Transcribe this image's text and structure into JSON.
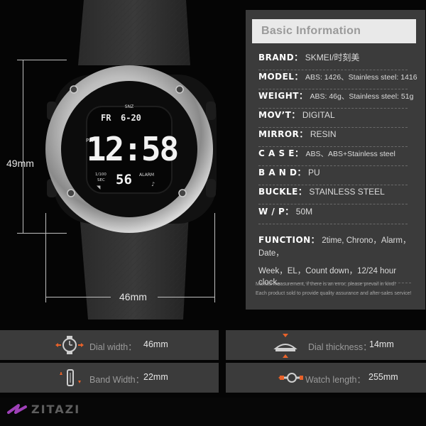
{
  "dimensions": {
    "height_label": "49mm",
    "width_label": "46mm"
  },
  "watch_face": {
    "snz": "SNZ",
    "day": "FR",
    "date": "6-20",
    "time": "12:58",
    "pm": "PM",
    "fraction": "1/100",
    "sec": "SEC",
    "seconds": "56",
    "alarm": "ALARM"
  },
  "info": {
    "title": "Basic Information",
    "rows": [
      {
        "key": "BRAND：",
        "value": "SKMEI/时刻美"
      },
      {
        "key": "MODEL：",
        "value": "ABS: 1426、Stainless steel: 1416"
      },
      {
        "key": "WEIGHT：",
        "value": "ABS: 46g、Stainless steel: 51g"
      },
      {
        "key": "MOV’T：",
        "value": "DIGITAL"
      },
      {
        "key": "MIRROR：",
        "value": "RESIN"
      },
      {
        "key": "C A S E：",
        "value": "ABS、ABS+Stainless steel"
      },
      {
        "key": "B A N D：",
        "value": "PU"
      },
      {
        "key": "BUCKLE：",
        "value": "STAINLESS STEEL"
      },
      {
        "key": "W / P：",
        "value": "50M"
      }
    ],
    "function_key": "FUNCTION：",
    "function_line1": "2time, Chrono，Alarm，Date，",
    "function_line2": "Week，EL，Count down，12/24 hour clock。",
    "note1": "Manual measurement, if there is an error, please prevail in kind!",
    "note2": "Each product sold to provide quality assurance and after-sales service!"
  },
  "specs": {
    "dial_width_label": "Dial width：",
    "dial_width_value": "46mm",
    "dial_thickness_label": "Dial thickness：",
    "dial_thickness_value": "14mm",
    "band_width_label": "Band Width：",
    "band_width_value": "22mm",
    "watch_length_label": "Watch length：",
    "watch_length_value": "255mm"
  },
  "logo": {
    "text": "ZITAZI"
  },
  "colors": {
    "panel": "#3b3b3b",
    "accent_orange": "#e8622a",
    "logo_purple": "#b84ad6"
  }
}
